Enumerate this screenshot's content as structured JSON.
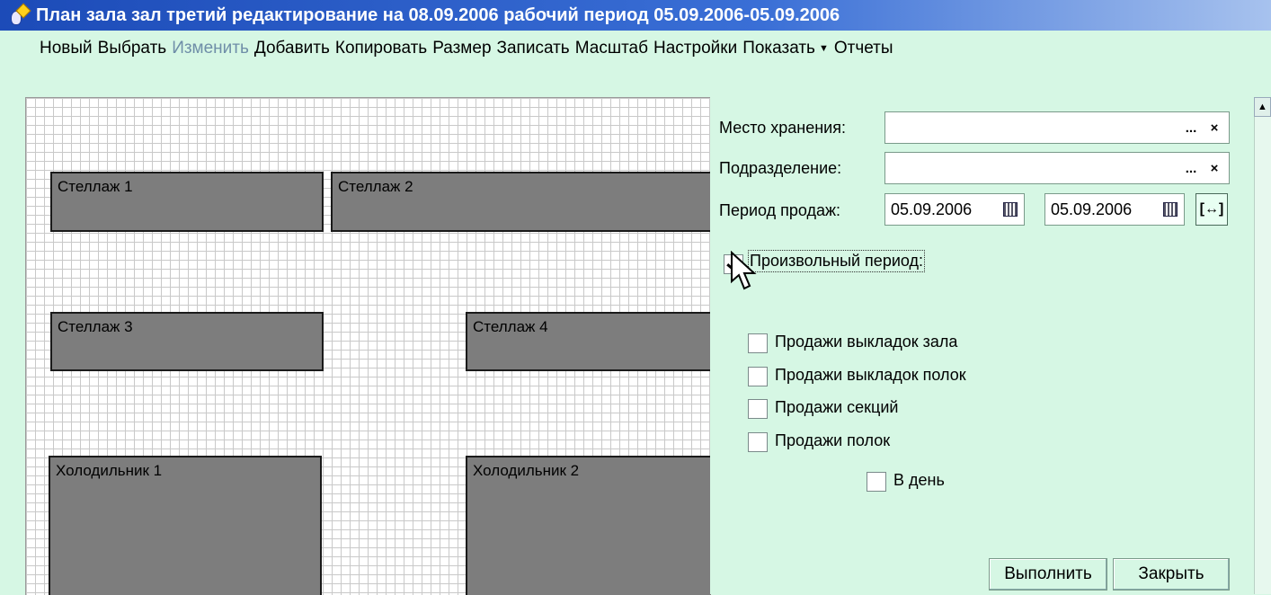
{
  "window": {
    "title": "План зала зал третий редактирование на 08.09.2006 рабочий период 05.09.2006-05.09.2006"
  },
  "menu": [
    {
      "label": "Новый",
      "enabled": true
    },
    {
      "label": "Выбрать",
      "enabled": true
    },
    {
      "label": "Изменить",
      "enabled": false
    },
    {
      "label": "Добавить",
      "enabled": true
    },
    {
      "label": "Копировать",
      "enabled": true
    },
    {
      "label": "Размер",
      "enabled": true
    },
    {
      "label": "Записать",
      "enabled": true
    },
    {
      "label": "Масштаб",
      "enabled": true
    },
    {
      "label": "Настройки",
      "enabled": true
    },
    {
      "label": "Показать",
      "enabled": true,
      "dropdown": true
    },
    {
      "label": "Отчеты",
      "enabled": true
    }
  ],
  "plan": {
    "shelves": [
      {
        "label": "Стеллаж 1"
      },
      {
        "label": "Стеллаж 2"
      },
      {
        "label": "Стеллаж 3"
      },
      {
        "label": "Стеллаж 4"
      },
      {
        "label": "Холодильник 1"
      },
      {
        "label": "Холодильник 2"
      }
    ]
  },
  "form": {
    "storage_label": "Место хранения:",
    "storage_value": "",
    "department_label": "Подразделение:",
    "department_value": "",
    "period_label": "Период продаж:",
    "period_from": "05.09.2006",
    "period_to": "05.09.2006",
    "select_button": "...",
    "clear_button": "×",
    "arbitrary_period_label": "Произвольный период:",
    "arbitrary_period_checked": true,
    "options": [
      {
        "label": "Продажи выкладок зала",
        "checked": false
      },
      {
        "label": "Продажи выкладок полок",
        "checked": false
      },
      {
        "label": "Продажи секций",
        "checked": false
      },
      {
        "label": "Продажи полок",
        "checked": false
      }
    ],
    "per_day_label": "В день",
    "per_day_checked": false,
    "run_button": "Выполнить",
    "close_button": "Закрыть"
  },
  "icons": {
    "app": "app-icon",
    "calendar": "calendar-icon",
    "range": "range-arrows-icon",
    "cursor": "mouse-cursor-icon"
  }
}
